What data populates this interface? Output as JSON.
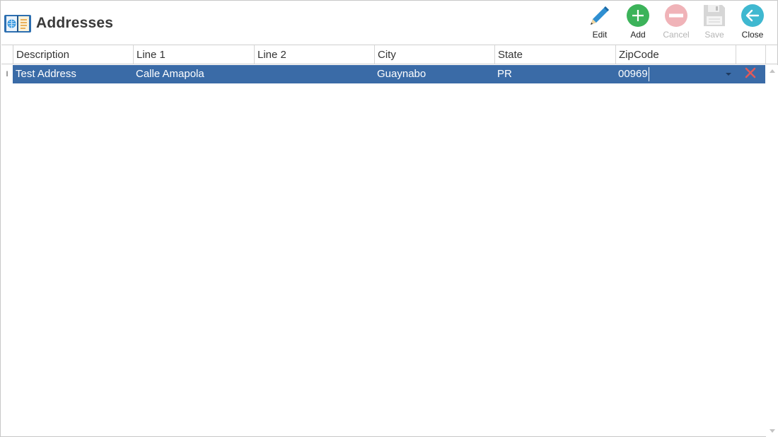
{
  "window": {
    "title": "Addresses"
  },
  "toolbar": {
    "edit_label": "Edit",
    "add_label": "Add",
    "cancel_label": "Cancel",
    "save_label": "Save",
    "close_label": "Close"
  },
  "icons": {
    "title": "address-book-icon",
    "edit": "pencil-icon",
    "add": "plus-circle-icon",
    "cancel": "minus-circle-icon",
    "save": "floppy-disk-icon",
    "close": "back-arrow-icon",
    "delete": "delete-x-icon",
    "row_indicator": "text-cursor-icon"
  },
  "colors": {
    "selected_row": "#3a6ba7",
    "add_green": "#3cb35a",
    "cancel_red_disabled": "#f0b3b8",
    "close_teal": "#3fb8d0",
    "edit_blue": "#2f8fd1",
    "delete_red": "#e05a5a"
  },
  "grid": {
    "columns": [
      "Description",
      "Line 1",
      "Line 2",
      "City",
      "State",
      "ZipCode"
    ],
    "rows": [
      {
        "indicator": "I",
        "description": "Test Address",
        "line1": "Calle Amapola",
        "line2": "",
        "city": "Guaynabo",
        "state": "PR",
        "zipcode": "00969"
      }
    ]
  }
}
